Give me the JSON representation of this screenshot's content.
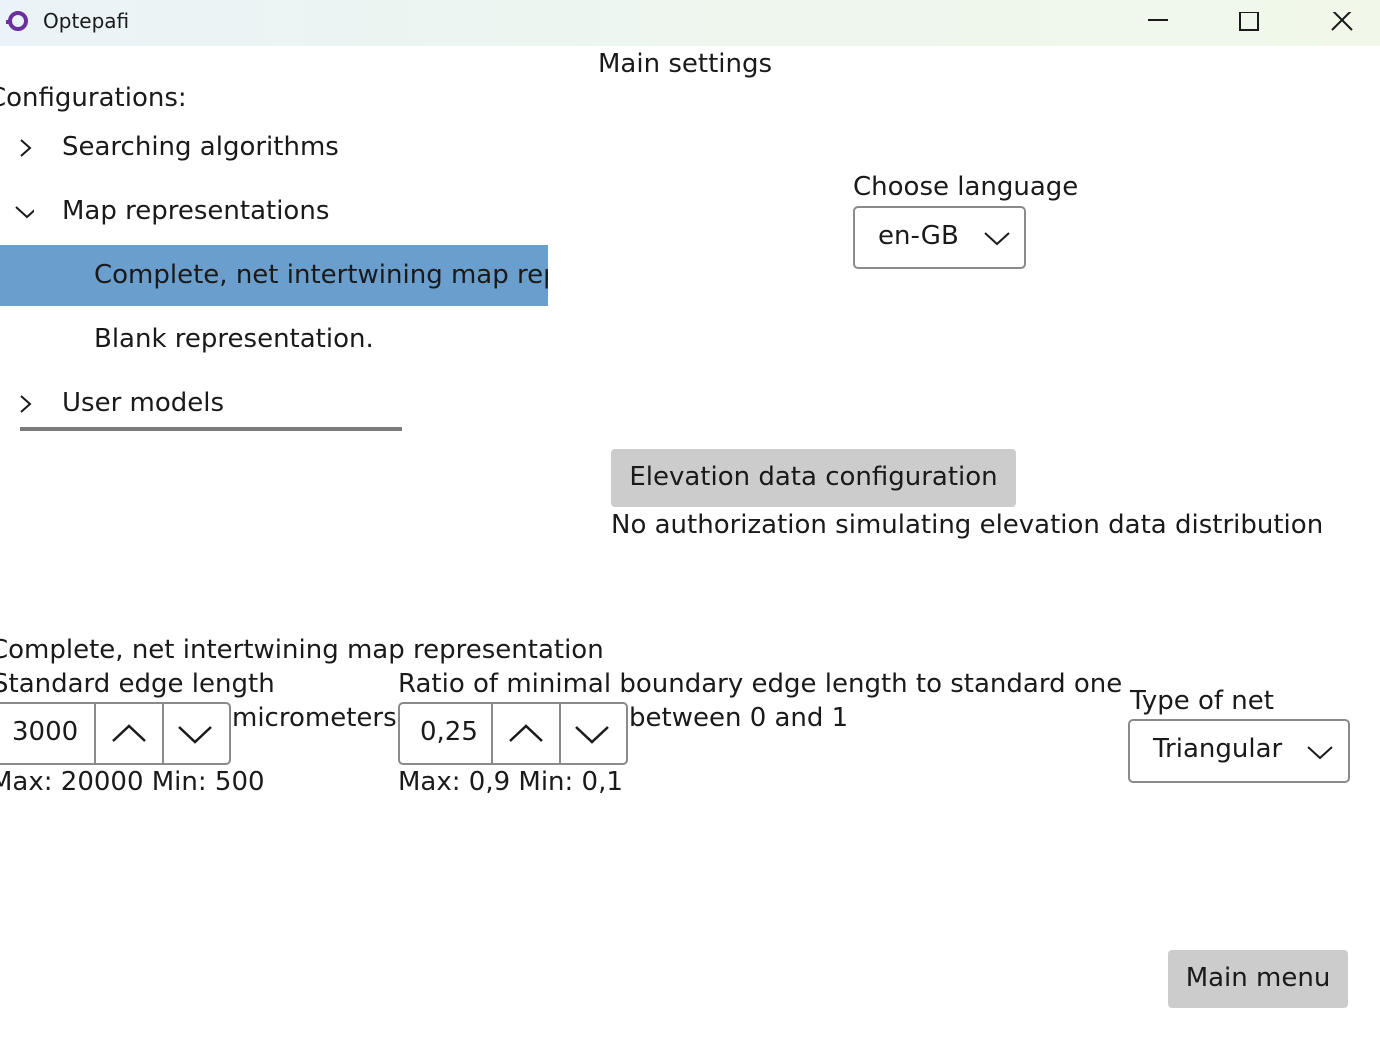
{
  "window": {
    "title": "Optepafi",
    "icon": "app-logo-icon",
    "controls": [
      "minimize-icon",
      "maximize-icon",
      "close-icon"
    ]
  },
  "header": {
    "title": "Main settings"
  },
  "configurations": {
    "label": "Configurations:",
    "tree": {
      "searching_algorithms": "Searching algorithms",
      "map_representations": "Map representations",
      "map_children": [
        "Complete, net intertwining map representation",
        "Blank representation."
      ],
      "user_models": "User models"
    }
  },
  "language": {
    "label": "Choose language",
    "selected": "en-GB"
  },
  "elevation": {
    "button": "Elevation data configuration",
    "status": "No authorization simulating elevation data distribution"
  },
  "representation": {
    "title": "Complete, net intertwining map representation",
    "edge_length": {
      "label": "Standard edge length",
      "value": "3000",
      "unit": "micrometers",
      "limits": "Max: 20000 Min: 500"
    },
    "ratio": {
      "label": "Ratio of minimal boundary edge length to standard one",
      "value": "0,25",
      "hint": "between 0 and 1",
      "limits": "Max: 0,9 Min: 0,1"
    },
    "net_type": {
      "label": "Type of net",
      "selected": "Triangular"
    }
  },
  "footer": {
    "main_menu": "Main menu"
  },
  "colors": {
    "selection": "#6a9ecd",
    "button_bg": "#cccccc",
    "app_icon": "#6b2fa0"
  }
}
